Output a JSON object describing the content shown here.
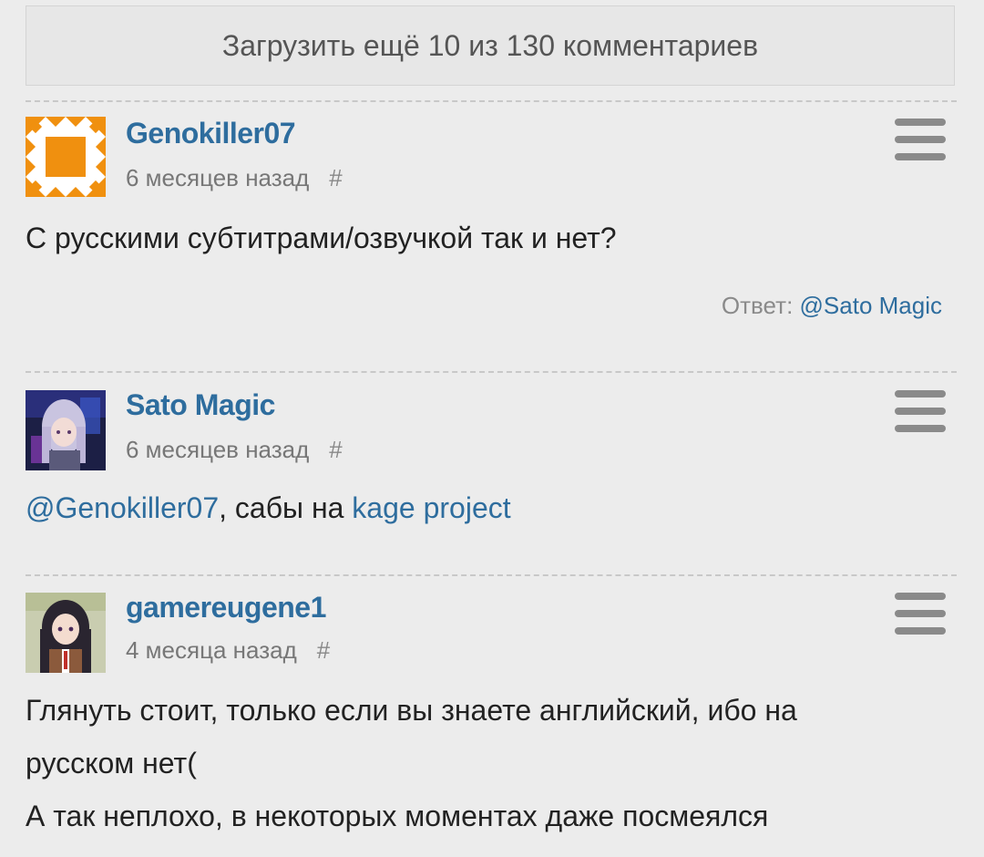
{
  "load_more": {
    "label": "Загрузить ещё 10 из 130 комментариев"
  },
  "comments": [
    {
      "author": "Genokiller07",
      "time": "6 месяцев назад",
      "hash": "#",
      "text": "С русскими субтитрами/озвучкой так и нет?",
      "reply_label": "Ответ:",
      "reply_target": "@Sato Magic",
      "avatar": "identicon-avatar",
      "avatar_color": "#f0900f"
    },
    {
      "author": "Sato Magic",
      "time": "6 месяцев назад",
      "hash": "#",
      "mention": "@Genokiller07",
      "text_middle": ", сабы на ",
      "link_text": "kage project",
      "avatar": "anime-girl-avatar"
    },
    {
      "author": "gamereugene1",
      "time": "4 месяца назад",
      "hash": "#",
      "text_lines": [
        "Глянуть стоит, только если вы знаете английский, ибо на",
        "русском нет(",
        "А так неплохо, в некоторых моментах даже посмеялся"
      ],
      "avatar": "anime-schoolgirl-avatar"
    }
  ],
  "colors": {
    "background": "#ececec",
    "author": "#2e6d9e",
    "link": "#2e6d9e",
    "muted": "#777777"
  },
  "icons": {
    "menu": "hamburger-menu-icon"
  }
}
